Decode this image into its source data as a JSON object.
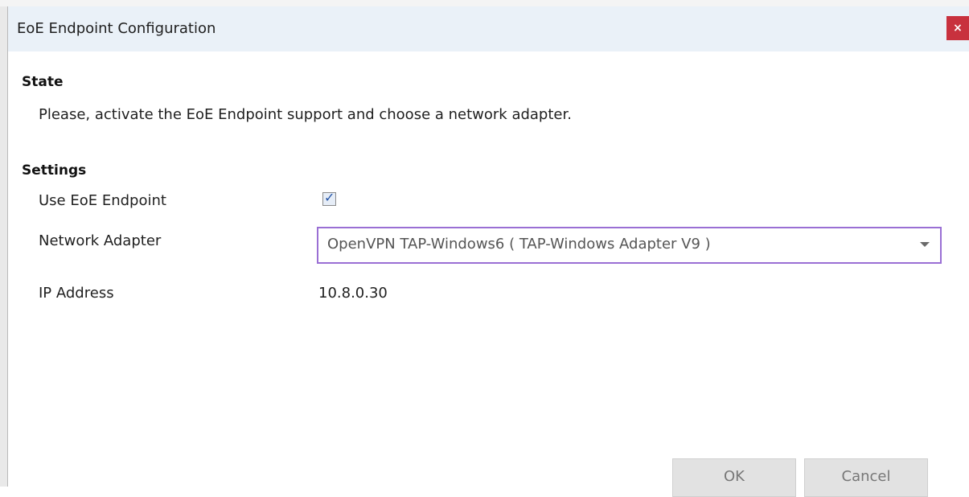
{
  "dialog": {
    "title": "EoE Endpoint Configuration",
    "close_label": "×"
  },
  "state": {
    "heading": "State",
    "message": "Please, activate the EoE Endpoint support and choose a network adapter."
  },
  "settings": {
    "heading": "Settings",
    "use_eoe_label": "Use EoE Endpoint",
    "use_eoe_checked": true,
    "check_glyph": "✓",
    "network_adapter_label": "Network Adapter",
    "network_adapter_value": "OpenVPN TAP-Windows6 ( TAP-Windows Adapter V9 )",
    "ip_address_label": "IP Address",
    "ip_address_value": "10.8.0.30"
  },
  "buttons": {
    "ok_label": "OK",
    "cancel_label": "Cancel"
  },
  "colors": {
    "close_button": "#c8313e",
    "dropdown_focus_border": "#9a6fd4",
    "titlebar_bg": "#eaf1f8"
  },
  "icons": {
    "close": "close-icon",
    "check": "check-icon",
    "dropdown": "chevron-down-icon"
  }
}
